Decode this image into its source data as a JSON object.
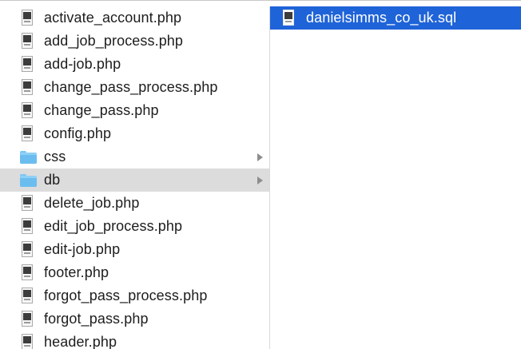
{
  "finder": {
    "column1": {
      "items": [
        {
          "name": "activate_account.php",
          "kind": "file"
        },
        {
          "name": "add_job_process.php",
          "kind": "file"
        },
        {
          "name": "add-job.php",
          "kind": "file"
        },
        {
          "name": "change_pass_process.php",
          "kind": "file"
        },
        {
          "name": "change_pass.php",
          "kind": "file"
        },
        {
          "name": "config.php",
          "kind": "file"
        },
        {
          "name": "css",
          "kind": "folder"
        },
        {
          "name": "db",
          "kind": "folder",
          "selected": true
        },
        {
          "name": "delete_job.php",
          "kind": "file"
        },
        {
          "name": "edit_job_process.php",
          "kind": "file"
        },
        {
          "name": "edit-job.php",
          "kind": "file"
        },
        {
          "name": "footer.php",
          "kind": "file"
        },
        {
          "name": "forgot_pass_process.php",
          "kind": "file"
        },
        {
          "name": "forgot_pass.php",
          "kind": "file"
        },
        {
          "name": "header.php",
          "kind": "file"
        }
      ]
    },
    "column2": {
      "items": [
        {
          "name": "danielsimms_co_uk.sql",
          "kind": "file",
          "selected": true
        }
      ]
    }
  },
  "colors": {
    "selection_active": "#1f63d8",
    "selection_inactive": "#dcdcdc",
    "folder": "#8fd0f6"
  },
  "icons": {
    "file": "php-file-icon",
    "sql_file": "sql-file-icon",
    "folder": "folder-icon",
    "disclosure": "chevron-right-icon"
  }
}
